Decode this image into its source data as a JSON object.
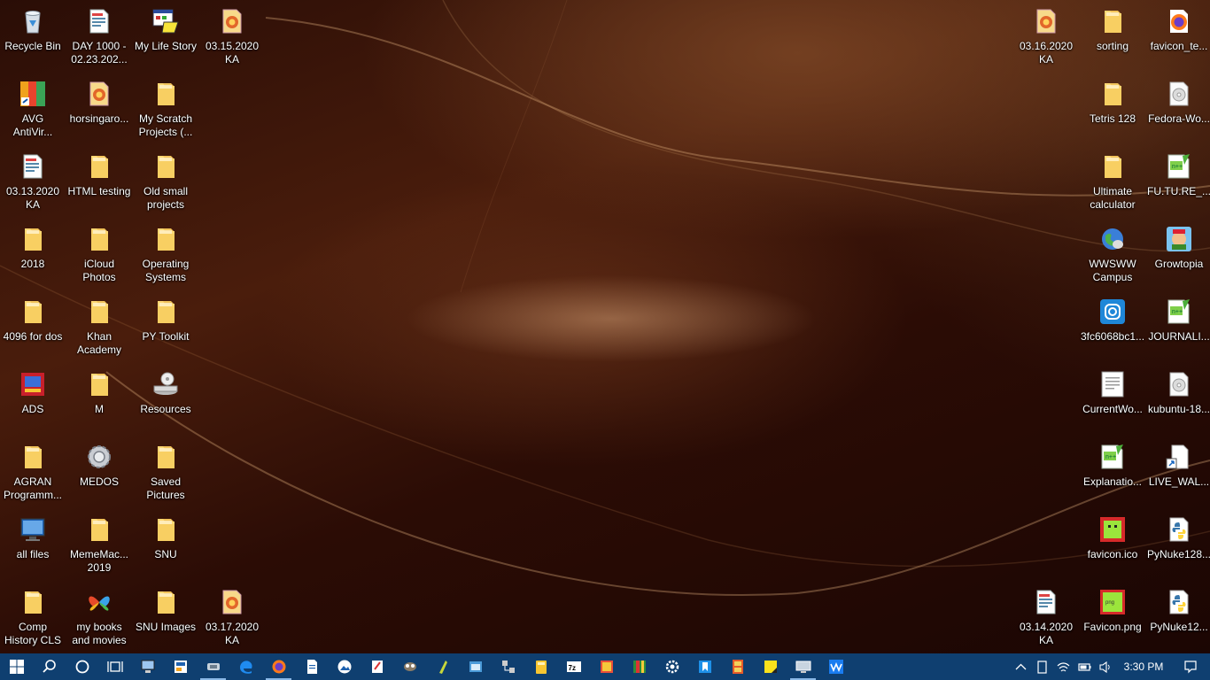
{
  "desktop": {
    "icons": [
      {
        "label": "Recycle Bin",
        "icon": "recycle-bin-icon",
        "kind": "bin",
        "col": 0,
        "row": 0
      },
      {
        "label": "DAY 1000 -\n02.23.202...",
        "icon": "file-icon",
        "kind": "doc",
        "col": 1,
        "row": 0
      },
      {
        "label": "My Life Story",
        "icon": "app-window-icon",
        "kind": "app",
        "col": 2,
        "row": 0
      },
      {
        "label": "03.15.2020\nKA",
        "icon": "image-file-icon",
        "kind": "image",
        "col": 3,
        "row": 0
      },
      {
        "label": "AVG\nAntiVir...",
        "icon": "avg-antivirus-icon",
        "kind": "avg",
        "col": 0,
        "row": 1
      },
      {
        "label": "horsingaro...",
        "icon": "image-file-icon",
        "kind": "image",
        "col": 1,
        "row": 1
      },
      {
        "label": "My Scratch\nProjects (...",
        "icon": "folder-icon",
        "kind": "folder",
        "col": 2,
        "row": 1
      },
      {
        "label": "03.13.2020\nKA",
        "icon": "document-icon",
        "kind": "doc",
        "col": 0,
        "row": 2
      },
      {
        "label": "HTML testing",
        "icon": "folder-icon",
        "kind": "folder",
        "col": 1,
        "row": 2
      },
      {
        "label": "Old small\nprojects",
        "icon": "folder-icon",
        "kind": "folder",
        "col": 2,
        "row": 2
      },
      {
        "label": "2018",
        "icon": "folder-icon",
        "kind": "folder",
        "col": 0,
        "row": 3
      },
      {
        "label": "iCloud\nPhotos",
        "icon": "folder-icon",
        "kind": "folder",
        "col": 1,
        "row": 3
      },
      {
        "label": "Operating\nSystems",
        "icon": "folder-icon",
        "kind": "folder",
        "col": 2,
        "row": 3
      },
      {
        "label": "4096 for dos",
        "icon": "folder-icon",
        "kind": "folder",
        "col": 0,
        "row": 4
      },
      {
        "label": "Khan\nAcademy",
        "icon": "folder-icon",
        "kind": "folder",
        "col": 1,
        "row": 4
      },
      {
        "label": "PY Toolkit",
        "icon": "folder-icon",
        "kind": "folder",
        "col": 2,
        "row": 4
      },
      {
        "label": "ADS",
        "icon": "ads-app-icon",
        "kind": "ads",
        "col": 0,
        "row": 5
      },
      {
        "label": "M",
        "icon": "folder-icon",
        "kind": "folder",
        "col": 1,
        "row": 5
      },
      {
        "label": "Resources",
        "icon": "drive-icon",
        "kind": "drive",
        "col": 2,
        "row": 5
      },
      {
        "label": "AGRAN\nProgramm...",
        "icon": "folder-icon",
        "kind": "folder",
        "col": 0,
        "row": 6
      },
      {
        "label": "MEDOS",
        "icon": "gear-disc-icon",
        "kind": "gear",
        "col": 1,
        "row": 6
      },
      {
        "label": "Saved\nPictures",
        "icon": "folder-icon",
        "kind": "folder",
        "col": 2,
        "row": 6
      },
      {
        "label": "all files",
        "icon": "monitor-icon",
        "kind": "monitor",
        "col": 0,
        "row": 7
      },
      {
        "label": "MemeMac...\n2019",
        "icon": "folder-icon",
        "kind": "folder",
        "col": 1,
        "row": 7
      },
      {
        "label": "SNU",
        "icon": "folder-icon",
        "kind": "folder",
        "col": 2,
        "row": 7
      },
      {
        "label": "Comp\nHistory CLS",
        "icon": "folder-icon",
        "kind": "folder",
        "col": 0,
        "row": 8
      },
      {
        "label": "my books\nand movies",
        "icon": "msn-butterfly-icon",
        "kind": "butterfly",
        "col": 1,
        "row": 8
      },
      {
        "label": "SNU Images",
        "icon": "folder-icon",
        "kind": "folder",
        "col": 2,
        "row": 8
      },
      {
        "label": "03.17.2020\nKA",
        "icon": "image-file-icon",
        "kind": "image",
        "col": 3,
        "row": 8
      },
      {
        "label": "03.16.2020\nKA",
        "icon": "image-file-icon",
        "kind": "image",
        "col": "r2",
        "row": 0
      },
      {
        "label": "sorting",
        "icon": "folder-icon",
        "kind": "folder",
        "col": "r1",
        "row": 0
      },
      {
        "label": "favicon_te...",
        "icon": "firefox-file-icon",
        "kind": "firefox",
        "col": "r0",
        "row": 0
      },
      {
        "label": "Tetris 128",
        "icon": "folder-icon",
        "kind": "folder",
        "col": "r1",
        "row": 1
      },
      {
        "label": "Fedora-Wo...",
        "icon": "disc-image-icon",
        "kind": "disc",
        "col": "r0",
        "row": 1
      },
      {
        "label": "Ultimate\ncalculator",
        "icon": "folder-icon",
        "kind": "folder",
        "col": "r1",
        "row": 2
      },
      {
        "label": "FU.TU.RE_...",
        "icon": "notepad-plus-icon",
        "kind": "npp",
        "col": "r0",
        "row": 2
      },
      {
        "label": "WWSWW\nCampus",
        "icon": "globe-icon",
        "kind": "globe",
        "col": "r1",
        "row": 3
      },
      {
        "label": "Growtopia",
        "icon": "growtopia-icon",
        "kind": "growtopia",
        "col": "r0",
        "row": 3
      },
      {
        "label": "3fc6068bc1...",
        "icon": "instagram-icon",
        "kind": "insta",
        "col": "r1",
        "row": 4
      },
      {
        "label": "JOURNALI...",
        "icon": "notepad-plus-icon",
        "kind": "npp",
        "col": "r0",
        "row": 4
      },
      {
        "label": "CurrentWo...",
        "icon": "text-document-icon",
        "kind": "txt",
        "col": "r1",
        "row": 5
      },
      {
        "label": "kubuntu-18...",
        "icon": "disc-image-icon",
        "kind": "disc",
        "col": "r0",
        "row": 5
      },
      {
        "label": "Explanatio...",
        "icon": "notepad-plus-icon",
        "kind": "npp",
        "col": "r1",
        "row": 6
      },
      {
        "label": "LIVE_WAL...",
        "icon": "shortcut-file-icon",
        "kind": "blank",
        "col": "r0",
        "row": 6
      },
      {
        "label": "favicon.ico",
        "icon": "favicon-icon",
        "kind": "favicon",
        "col": "r1",
        "row": 7
      },
      {
        "label": "PyNuke128...",
        "icon": "python-file-icon",
        "kind": "python",
        "col": "r0",
        "row": 7
      },
      {
        "label": "03.14.2020\nKA",
        "icon": "document-icon",
        "kind": "doc",
        "col": "r2",
        "row": 8
      },
      {
        "label": "Favicon.png",
        "icon": "png-image-icon",
        "kind": "favpng",
        "col": "r1",
        "row": 8
      },
      {
        "label": "PyNuke12...",
        "icon": "python-file-icon",
        "kind": "python",
        "col": "r0",
        "row": 8
      }
    ]
  },
  "taskbar": {
    "buttons": [
      {
        "icon": "windows-start-icon",
        "active": false
      },
      {
        "icon": "search-icon",
        "active": false
      },
      {
        "icon": "cortana-icon",
        "active": false
      },
      {
        "icon": "task-view-icon",
        "active": false
      },
      {
        "icon": "computer-icon",
        "active": false
      },
      {
        "icon": "app-icon",
        "active": false
      },
      {
        "icon": "vmware-icon",
        "active": true
      },
      {
        "icon": "edge-icon",
        "active": false
      },
      {
        "icon": "firefox-icon",
        "active": true
      },
      {
        "icon": "document-icon",
        "active": false
      },
      {
        "icon": "photos-icon",
        "active": false
      },
      {
        "icon": "paint-icon",
        "active": false
      },
      {
        "icon": "gimp-icon",
        "active": false
      },
      {
        "icon": "torch-icon",
        "active": false
      },
      {
        "icon": "settings-window-icon",
        "active": false
      },
      {
        "icon": "network-icon",
        "active": false
      },
      {
        "icon": "folder-icon",
        "active": false
      },
      {
        "icon": "7zip-icon",
        "active": false
      },
      {
        "icon": "image-viewer-icon",
        "active": false
      },
      {
        "icon": "archive-icon",
        "active": false
      },
      {
        "icon": "gear-icon",
        "active": false
      },
      {
        "icon": "bookmark-icon",
        "active": false
      },
      {
        "icon": "film-icon",
        "active": false
      },
      {
        "icon": "sticky-notes-icon",
        "active": false
      },
      {
        "icon": "remote-desktop-icon",
        "active": true
      },
      {
        "icon": "waves-icon",
        "active": false
      }
    ],
    "tray": {
      "icons": [
        "chevron-up-icon",
        "tablet-icon",
        "wifi-icon",
        "battery-icon",
        "volume-icon"
      ],
      "time": "3:30 PM"
    }
  }
}
